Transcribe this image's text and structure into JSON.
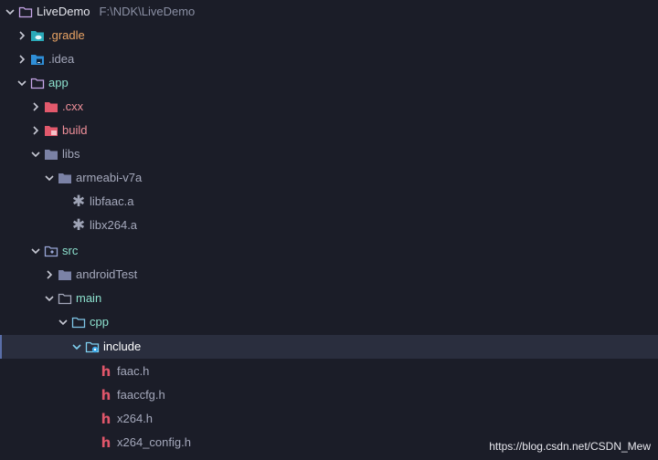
{
  "project": {
    "name": "LiveDemo",
    "path": "F:\\NDK\\LiveDemo"
  },
  "tree": [
    {
      "label": "LiveDemo",
      "icon": "folder-outline-icon",
      "chev": "down"
    },
    {
      "label": ".gradle",
      "icon": "gradle-folder-icon",
      "chev": "right"
    },
    {
      "label": ".idea",
      "icon": "idea-folder-icon",
      "chev": "right"
    },
    {
      "label": "app",
      "icon": "folder-outline-icon",
      "chev": "down"
    },
    {
      "label": ".cxx",
      "icon": "red-folder-icon",
      "chev": "right"
    },
    {
      "label": "build",
      "icon": "red-folder-icon",
      "chev": "right"
    },
    {
      "label": "libs",
      "icon": "folder-icon",
      "chev": "down"
    },
    {
      "label": "armeabi-v7a",
      "icon": "folder-icon",
      "chev": "down"
    },
    {
      "label": "libfaac.a",
      "icon": "asterisk-file-icon",
      "chev": "none"
    },
    {
      "label": "libx264.a",
      "icon": "asterisk-file-icon",
      "chev": "none"
    },
    {
      "label": "src",
      "icon": "source-folder-icon",
      "chev": "down"
    },
    {
      "label": "androidTest",
      "icon": "folder-icon",
      "chev": "right"
    },
    {
      "label": "main",
      "icon": "folder-outline-icon",
      "chev": "down"
    },
    {
      "label": "cpp",
      "icon": "folder-outline-icon",
      "chev": "down"
    },
    {
      "label": "include",
      "icon": "include-folder-icon",
      "chev": "down"
    },
    {
      "label": "faac.h",
      "icon": "h-file-icon",
      "chev": "none"
    },
    {
      "label": "faaccfg.h",
      "icon": "h-file-icon",
      "chev": "none"
    },
    {
      "label": "x264.h",
      "icon": "h-file-icon",
      "chev": "none"
    },
    {
      "label": "x264_config.h",
      "icon": "h-file-icon",
      "chev": "none"
    }
  ],
  "watermark": "https://blog.csdn.net/CSDN_Mew",
  "colors": {
    "background": "#1b1d28",
    "selection": "#2a2e3e",
    "header_file": "#e0566a"
  }
}
